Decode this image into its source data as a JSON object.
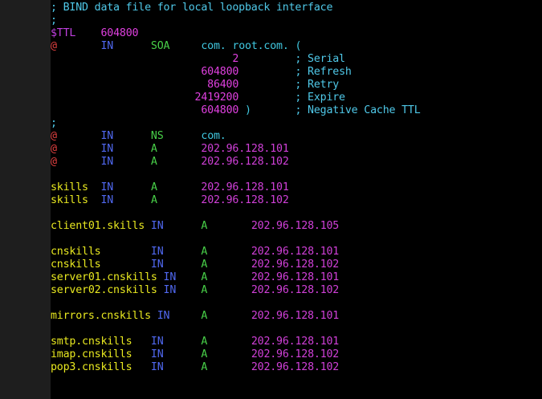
{
  "colors": {
    "background": "#000000",
    "comment": "#4fc8e8",
    "variable": "#c040e0",
    "origin": "#e04040",
    "record_class": "#5068f0",
    "record_type": "#48d048",
    "domain": "#40c8e0",
    "address": "#d040d8",
    "hostname": "#e8e820",
    "number": "#e040e0"
  },
  "lines": [
    [
      {
        "t": "; BIND data file for local loopback interface",
        "c": "comment"
      }
    ],
    [
      {
        "t": ";",
        "c": "comment"
      }
    ],
    [
      {
        "t": "$TTL",
        "c": "variable"
      },
      {
        "t": "    "
      },
      {
        "t": "604800",
        "c": "number"
      }
    ],
    [
      {
        "t": "@",
        "c": "origin"
      },
      {
        "t": "       "
      },
      {
        "t": "IN",
        "c": "record_class"
      },
      {
        "t": "      "
      },
      {
        "t": "SOA",
        "c": "record_type"
      },
      {
        "t": "     "
      },
      {
        "t": "com. root.com. (",
        "c": "domain"
      }
    ],
    [
      {
        "t": "                             "
      },
      {
        "t": "2",
        "c": "number"
      },
      {
        "t": "         "
      },
      {
        "t": "; Serial",
        "c": "comment"
      }
    ],
    [
      {
        "t": "                        "
      },
      {
        "t": "604800",
        "c": "number"
      },
      {
        "t": "         "
      },
      {
        "t": "; Refresh",
        "c": "comment"
      }
    ],
    [
      {
        "t": "                         "
      },
      {
        "t": "86400",
        "c": "number"
      },
      {
        "t": "         "
      },
      {
        "t": "; Retry",
        "c": "comment"
      }
    ],
    [
      {
        "t": "                       "
      },
      {
        "t": "2419200",
        "c": "number"
      },
      {
        "t": "         "
      },
      {
        "t": "; Expire",
        "c": "comment"
      }
    ],
    [
      {
        "t": "                        "
      },
      {
        "t": "604800",
        "c": "number"
      },
      {
        "t": " )       ",
        "c": "domain"
      },
      {
        "t": "; Negative Cache TTL",
        "c": "comment"
      }
    ],
    [
      {
        "t": ";",
        "c": "comment"
      }
    ],
    [
      {
        "t": "@",
        "c": "origin"
      },
      {
        "t": "       "
      },
      {
        "t": "IN",
        "c": "record_class"
      },
      {
        "t": "      "
      },
      {
        "t": "NS",
        "c": "record_type"
      },
      {
        "t": "      "
      },
      {
        "t": "com.",
        "c": "domain"
      }
    ],
    [
      {
        "t": "@",
        "c": "origin"
      },
      {
        "t": "       "
      },
      {
        "t": "IN",
        "c": "record_class"
      },
      {
        "t": "      "
      },
      {
        "t": "A",
        "c": "record_type"
      },
      {
        "t": "       "
      },
      {
        "t": "202.96.128.101",
        "c": "address"
      }
    ],
    [
      {
        "t": "@",
        "c": "origin"
      },
      {
        "t": "       "
      },
      {
        "t": "IN",
        "c": "record_class"
      },
      {
        "t": "      "
      },
      {
        "t": "A",
        "c": "record_type"
      },
      {
        "t": "       "
      },
      {
        "t": "202.96.128.102",
        "c": "address"
      }
    ],
    [
      {
        "t": ""
      }
    ],
    [
      {
        "t": "skills",
        "c": "hostname"
      },
      {
        "t": "  "
      },
      {
        "t": "IN",
        "c": "record_class"
      },
      {
        "t": "      "
      },
      {
        "t": "A",
        "c": "record_type"
      },
      {
        "t": "       "
      },
      {
        "t": "202.96.128.101",
        "c": "address"
      }
    ],
    [
      {
        "t": "skills",
        "c": "hostname"
      },
      {
        "t": "  "
      },
      {
        "t": "IN",
        "c": "record_class"
      },
      {
        "t": "      "
      },
      {
        "t": "A",
        "c": "record_type"
      },
      {
        "t": "       "
      },
      {
        "t": "202.96.128.102",
        "c": "address"
      }
    ],
    [
      {
        "t": ""
      }
    ],
    [
      {
        "t": "client01.skills",
        "c": "hostname"
      },
      {
        "t": " "
      },
      {
        "t": "IN",
        "c": "record_class"
      },
      {
        "t": "      "
      },
      {
        "t": "A",
        "c": "record_type"
      },
      {
        "t": "       "
      },
      {
        "t": "202.96.128.105",
        "c": "address"
      }
    ],
    [
      {
        "t": ""
      }
    ],
    [
      {
        "t": "cnskills",
        "c": "hostname"
      },
      {
        "t": "        "
      },
      {
        "t": "IN",
        "c": "record_class"
      },
      {
        "t": "      "
      },
      {
        "t": "A",
        "c": "record_type"
      },
      {
        "t": "       "
      },
      {
        "t": "202.96.128.101",
        "c": "address"
      }
    ],
    [
      {
        "t": "cnskills",
        "c": "hostname"
      },
      {
        "t": "        "
      },
      {
        "t": "IN",
        "c": "record_class"
      },
      {
        "t": "      "
      },
      {
        "t": "A",
        "c": "record_type"
      },
      {
        "t": "       "
      },
      {
        "t": "202.96.128.102",
        "c": "address"
      }
    ],
    [
      {
        "t": "server01.cnskills",
        "c": "hostname"
      },
      {
        "t": " "
      },
      {
        "t": "IN",
        "c": "record_class"
      },
      {
        "t": "    "
      },
      {
        "t": "A",
        "c": "record_type"
      },
      {
        "t": "       "
      },
      {
        "t": "202.96.128.101",
        "c": "address"
      }
    ],
    [
      {
        "t": "server02.cnskills",
        "c": "hostname"
      },
      {
        "t": " "
      },
      {
        "t": "IN",
        "c": "record_class"
      },
      {
        "t": "    "
      },
      {
        "t": "A",
        "c": "record_type"
      },
      {
        "t": "       "
      },
      {
        "t": "202.96.128.102",
        "c": "address"
      }
    ],
    [
      {
        "t": ""
      }
    ],
    [
      {
        "t": "mirrors.cnskills",
        "c": "hostname"
      },
      {
        "t": " "
      },
      {
        "t": "IN",
        "c": "record_class"
      },
      {
        "t": "     "
      },
      {
        "t": "A",
        "c": "record_type"
      },
      {
        "t": "       "
      },
      {
        "t": "202.96.128.101",
        "c": "address"
      }
    ],
    [
      {
        "t": ""
      }
    ],
    [
      {
        "t": "smtp.cnskills",
        "c": "hostname"
      },
      {
        "t": "   "
      },
      {
        "t": "IN",
        "c": "record_class"
      },
      {
        "t": "      "
      },
      {
        "t": "A",
        "c": "record_type"
      },
      {
        "t": "       "
      },
      {
        "t": "202.96.128.101",
        "c": "address"
      }
    ],
    [
      {
        "t": "imap.cnskills",
        "c": "hostname"
      },
      {
        "t": "   "
      },
      {
        "t": "IN",
        "c": "record_class"
      },
      {
        "t": "      "
      },
      {
        "t": "A",
        "c": "record_type"
      },
      {
        "t": "       "
      },
      {
        "t": "202.96.128.102",
        "c": "address"
      }
    ],
    [
      {
        "t": "pop3.cnskills",
        "c": "hostname"
      },
      {
        "t": "   "
      },
      {
        "t": "IN",
        "c": "record_class"
      },
      {
        "t": "      "
      },
      {
        "t": "A",
        "c": "record_type"
      },
      {
        "t": "       "
      },
      {
        "t": "202.96.128.102",
        "c": "address"
      }
    ]
  ]
}
